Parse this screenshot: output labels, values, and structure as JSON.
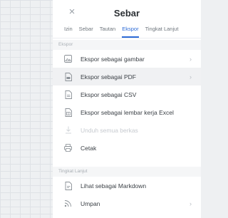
{
  "panel": {
    "title": "Sebar"
  },
  "tabs": [
    {
      "label": "Izin"
    },
    {
      "label": "Sebar"
    },
    {
      "label": "Tautan"
    },
    {
      "label": "Ekspor"
    },
    {
      "label": "Tingkat Lanjut"
    }
  ],
  "active_tab": "Ekspor",
  "sections": {
    "export": "Ekspor",
    "advanced": "Tingkat Lanjut"
  },
  "export_items": [
    {
      "label": "Ekspor sebagai gambar",
      "icon": "image-icon",
      "has_submenu": true
    },
    {
      "label": "Ekspor sebagai PDF",
      "icon": "pdf-icon",
      "has_submenu": true
    },
    {
      "label": "Ekspor sebagai CSV",
      "icon": "csv-icon",
      "has_submenu": false
    },
    {
      "label": "Ekspor sebagai lembar kerja Excel",
      "icon": "excel-icon",
      "has_submenu": false
    },
    {
      "label": "Unduh semua berkas",
      "icon": "download-icon",
      "has_submenu": false,
      "disabled": true
    },
    {
      "label": "Cetak",
      "icon": "print-icon",
      "has_submenu": false
    }
  ],
  "advanced_items": [
    {
      "label": "Lihat sebagai Markdown",
      "icon": "markdown-icon",
      "has_submenu": false
    },
    {
      "label": "Umpan",
      "icon": "rss-icon",
      "has_submenu": true
    }
  ],
  "colors": {
    "accent": "#2d6bd6",
    "text": "#3b4046",
    "muted": "#a9afb5",
    "disabled": "#c6cacf"
  }
}
